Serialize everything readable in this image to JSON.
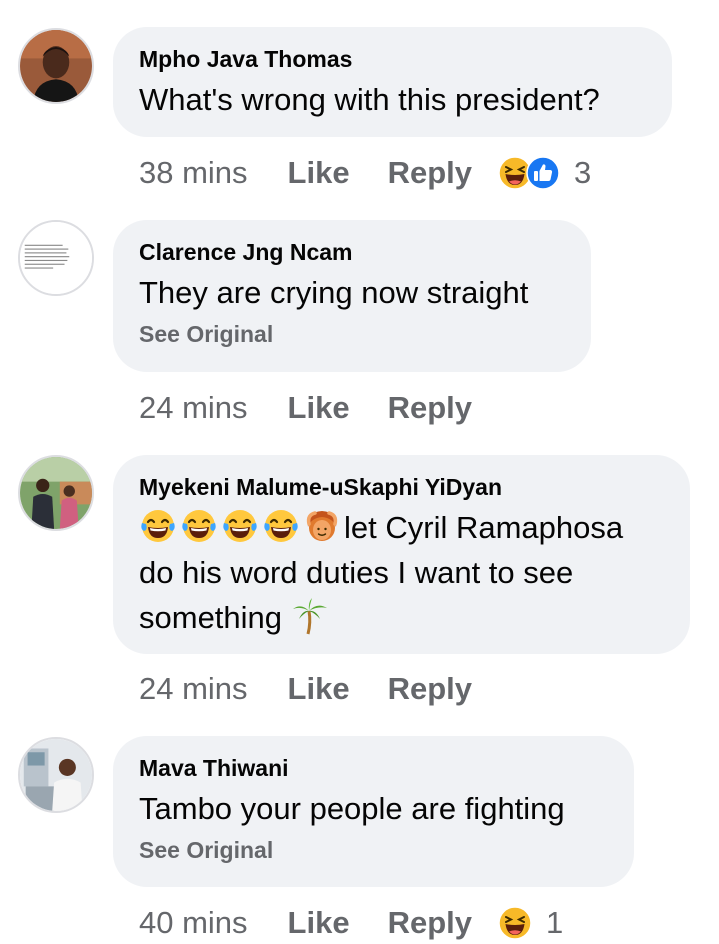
{
  "comments": [
    {
      "author": "Mpho Java Thomas",
      "text": "What's wrong with this president?",
      "time": "38 mins",
      "like_label": "Like",
      "reply_label": "Reply",
      "reactions": [
        "laughing-reaction",
        "like-reaction"
      ],
      "reaction_count": "3"
    },
    {
      "author": "Clarence Jng Ncam",
      "text": "They are crying now straight",
      "see_original": "See Original",
      "time": "24 mins",
      "like_label": "Like",
      "reply_label": "Reply",
      "avatar_text": "Dear God, I want to thank you for all those things you do that I never see. Helping me get through each day safely, making sure my family is protected and Your many other countless blessings. Amen."
    },
    {
      "author": "Myekeni Malume-uSkaphi YiDyan",
      "emojis": [
        "face-with-tears-of-joy",
        "face-with-tears-of-joy",
        "face-with-tears-of-joy",
        "face-with-tears-of-joy",
        "person-gesturing-ok"
      ],
      "text_line1": "let Cyril Ramaphosa",
      "text_line2": "do his word duties I want to see",
      "text_line3": "something",
      "trailing_emoji": "palm-tree",
      "time": "24 mins",
      "like_label": "Like",
      "reply_label": "Reply"
    },
    {
      "author": "Mava Thiwani",
      "text": "Tambo your people are fighting",
      "see_original": "See Original",
      "time": "40 mins",
      "like_label": "Like",
      "reply_label": "Reply",
      "reactions": [
        "laughing-reaction"
      ],
      "reaction_count": "1"
    }
  ],
  "colors": {
    "bubble": "#f0f2f5",
    "meta_text": "#65676b",
    "name_text": "#050505",
    "like_blue": "#1877f2",
    "haha_yellow": "#f7b125"
  }
}
